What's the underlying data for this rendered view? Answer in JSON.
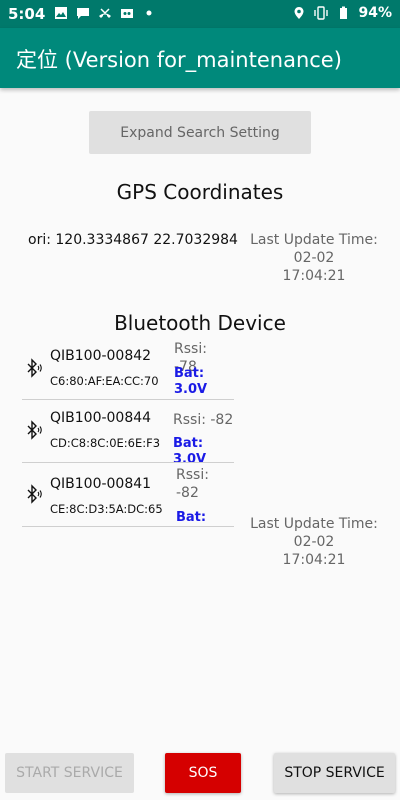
{
  "status_bar": {
    "time": "5:04",
    "battery": "94%",
    "left_icons": [
      "image-icon",
      "chat-icon",
      "missed-call-icon",
      "voicemail-icon",
      "dot-icon"
    ],
    "right_icons": [
      "location-icon",
      "vibrate-icon",
      "battery-icon"
    ],
    "color": "#00796b"
  },
  "app_bar": {
    "title": "定位 (Version for_maintenance)",
    "color": "#00897b"
  },
  "expand_button": "Expand Search Setting",
  "gps": {
    "title": "GPS Coordinates",
    "ori": "ori: 120.3334867 22.7032984",
    "last_update_label": "Last Update Time:",
    "last_update_date": "02-02",
    "last_update_time": "17:04:21"
  },
  "bluetooth": {
    "title": "Bluetooth Device",
    "devices": [
      {
        "name": "QIB100-00842",
        "mac": "C6:80:AF:EA:CC:70",
        "rssi": "Rssi: -78",
        "bat_label": "Bat:",
        "bat_value": "3.0V"
      },
      {
        "name": "QIB100-00844",
        "mac": "CD:C8:8C:0E:6E:F3",
        "rssi": "Rssi: -82",
        "bat_label": "Bat:",
        "bat_value": "3.0V"
      },
      {
        "name": "QIB100-00841",
        "mac": "CE:8C:D3:5A:DC:65",
        "rssi_label": "Rssi:",
        "rssi_value": "-82",
        "bat_label": "Bat:"
      }
    ],
    "last_update_label": "Last Update Time:",
    "last_update_date": "02-02",
    "last_update_time": "17:04:21"
  },
  "buttons": {
    "start": "START SERVICE",
    "sos": "SOS",
    "stop": "STOP SERVICE",
    "sos_color": "#d50000"
  }
}
